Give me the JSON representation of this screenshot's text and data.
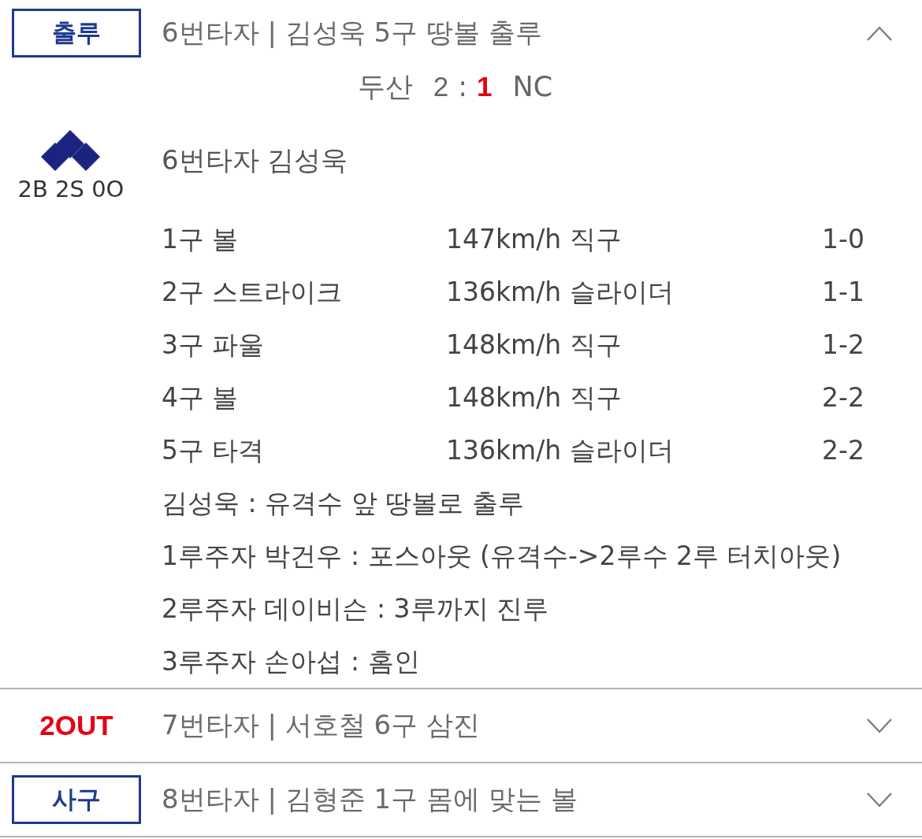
{
  "plays": [
    {
      "badge": {
        "kind": "box",
        "text": "출루"
      },
      "title": "6번타자 | 김성욱 5구 땅볼 출루",
      "expanded": true,
      "detail": {
        "score": {
          "teams": [
            {
              "name": "두산",
              "score": "2",
              "scored": false
            },
            {
              "name": "NC",
              "score": "1",
              "scored": true
            }
          ],
          "separator": ":"
        },
        "bases": {
          "first": true,
          "second": true,
          "third": true
        },
        "count": "2B 2S 0O",
        "batter": "6번타자 김성욱",
        "pitches": [
          {
            "number": "1구 볼",
            "pitch": "147km/h 직구",
            "count": "1-0"
          },
          {
            "number": "2구 스트라이크",
            "pitch": "136km/h 슬라이더",
            "count": "1-1"
          },
          {
            "number": "3구 파울",
            "pitch": "148km/h 직구",
            "count": "1-2"
          },
          {
            "number": "4구 볼",
            "pitch": "148km/h 직구",
            "count": "2-2"
          },
          {
            "number": "5구 타격",
            "pitch": "136km/h 슬라이더",
            "count": "2-2"
          }
        ],
        "results": [
          "김성욱 : 유격수 앞 땅볼로 출루",
          "1루주자 박건우 : 포스아웃 (유격수->2루수 2루 터치아웃)",
          "2루주자 데이비슨 : 3루까지 진루",
          "3루주자 손아섭 : 홈인"
        ]
      }
    },
    {
      "badge": {
        "kind": "out",
        "text": "2OUT"
      },
      "title": "7번타자 | 서호철 6구 삼진",
      "expanded": false
    },
    {
      "badge": {
        "kind": "box",
        "text": "사구"
      },
      "title": "8번타자 | 김형준 1구 몸에 맞는 볼",
      "expanded": false
    }
  ]
}
